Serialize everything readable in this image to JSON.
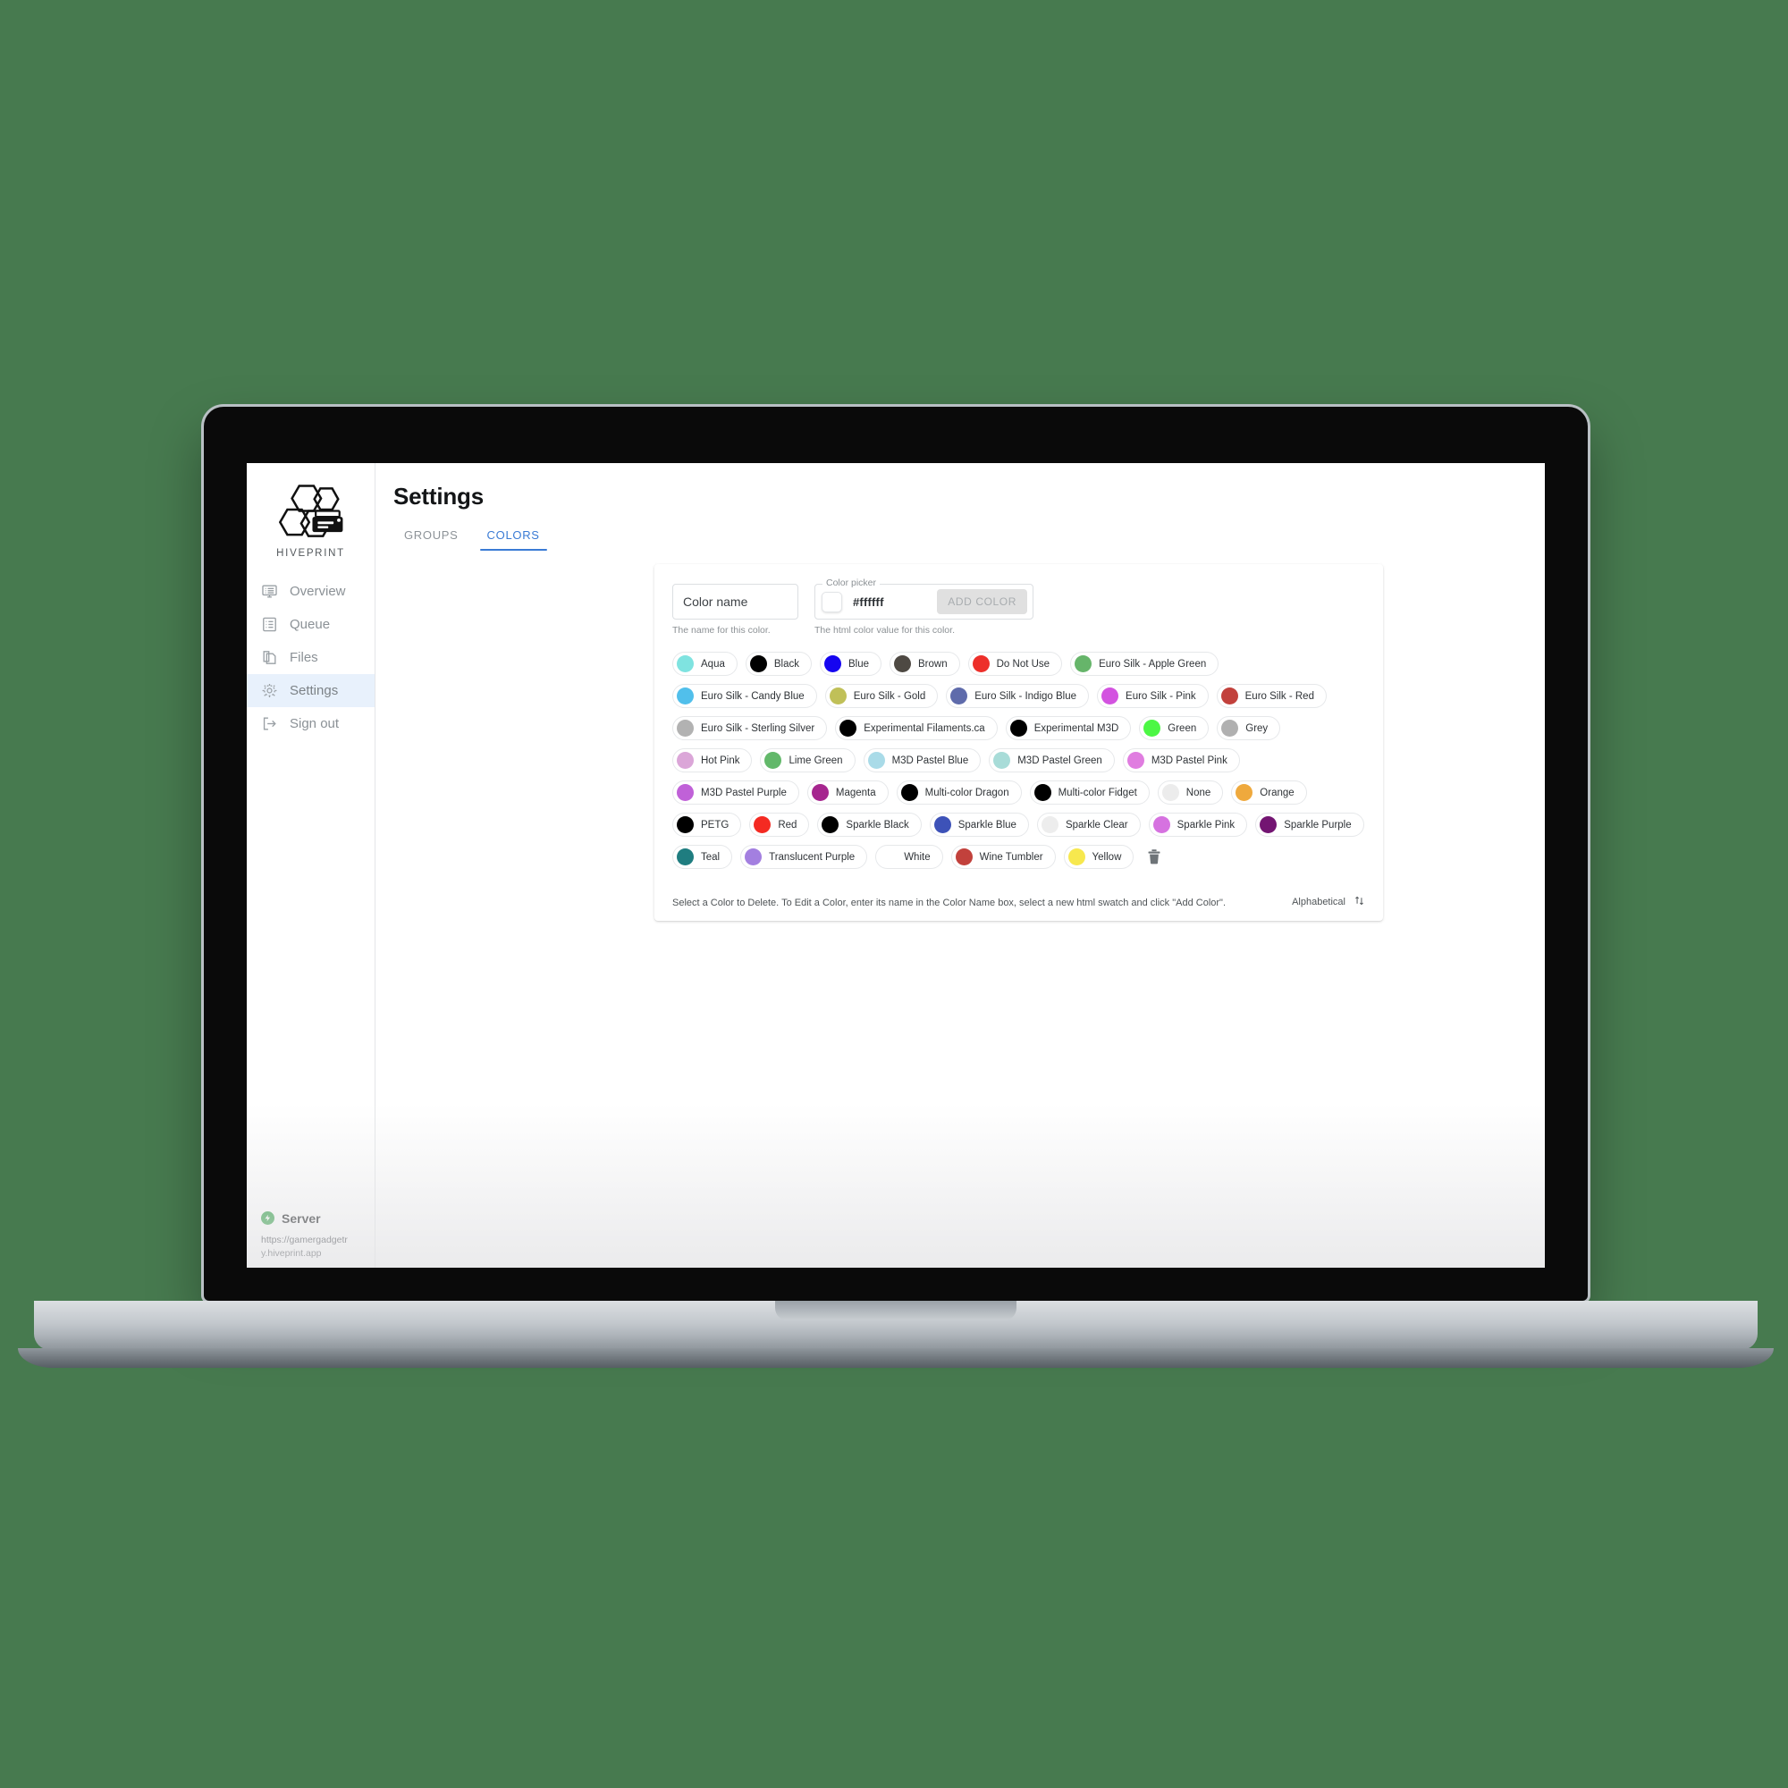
{
  "theme": {
    "background": "#477a4f",
    "accent": "#3a7bd5",
    "sidebar_active_bg": "#e8f1fc",
    "server_status_color": "#2e9e44"
  },
  "sidebar": {
    "brand_name": "HIVEPRINT",
    "brand_logo_icon": "hive-printer-logo",
    "items": [
      {
        "label": "Overview",
        "icon": "dashboard-icon",
        "active": false
      },
      {
        "label": "Queue",
        "icon": "list-icon",
        "active": false
      },
      {
        "label": "Files",
        "icon": "files-icon",
        "active": false
      },
      {
        "label": "Settings",
        "icon": "gear-icon",
        "active": true
      },
      {
        "label": "Sign out",
        "icon": "sign-out-icon",
        "active": false
      }
    ],
    "server": {
      "status_icon": "lightning-bolt-icon",
      "label": "Server",
      "url": "https://gamergadgetry.hiveprint.app"
    }
  },
  "header": {
    "title": "Settings",
    "tabs": [
      {
        "label": "GROUPS",
        "active": false
      },
      {
        "label": "COLORS",
        "active": true
      }
    ]
  },
  "form": {
    "color_name": {
      "placeholder": "Color name",
      "value": "",
      "help": "The name for this color."
    },
    "color_picker": {
      "legend": "Color picker",
      "swatch_hex": "#ffffff",
      "hex_value": "#ffffff",
      "help": "The html color value for this color."
    },
    "add_color_label": "ADD COLOR"
  },
  "colors": [
    {
      "name": "Aqua",
      "hex": "#7fe3e0"
    },
    {
      "name": "Black",
      "hex": "#000000"
    },
    {
      "name": "Blue",
      "hex": "#1505f0"
    },
    {
      "name": "Brown",
      "hex": "#4e4943"
    },
    {
      "name": "Do Not Use",
      "hex": "#ed2f2a"
    },
    {
      "name": "Euro Silk - Apple Green",
      "hex": "#66b56a"
    },
    {
      "name": "Euro Silk - Candy Blue",
      "hex": "#51bfeb"
    },
    {
      "name": "Euro Silk - Gold",
      "hex": "#c0c058"
    },
    {
      "name": "Euro Silk - Indigo Blue",
      "hex": "#5f6bab"
    },
    {
      "name": "Euro Silk - Pink",
      "hex": "#d353e0"
    },
    {
      "name": "Euro Silk - Red",
      "hex": "#c2413c"
    },
    {
      "name": "Euro Silk - Sterling Silver",
      "hex": "#b2b2b2"
    },
    {
      "name": "Experimental Filaments.ca",
      "hex": "#000000"
    },
    {
      "name": "Experimental M3D",
      "hex": "#000000"
    },
    {
      "name": "Green",
      "hex": "#4cf744"
    },
    {
      "name": "Grey",
      "hex": "#b0b0b0"
    },
    {
      "name": "Hot Pink",
      "hex": "#dba6d8"
    },
    {
      "name": "Lime Green",
      "hex": "#62b86a"
    },
    {
      "name": "M3D Pastel Blue",
      "hex": "#a9dbe8"
    },
    {
      "name": "M3D Pastel Green",
      "hex": "#a8dcd8"
    },
    {
      "name": "M3D Pastel Pink",
      "hex": "#e07de0"
    },
    {
      "name": "M3D Pastel Purple",
      "hex": "#c061d8"
    },
    {
      "name": "Magenta",
      "hex": "#a6268f"
    },
    {
      "name": "Multi-color Dragon",
      "hex": "#000000"
    },
    {
      "name": "Multi-color Fidget",
      "hex": "#000000"
    },
    {
      "name": "None",
      "hex": "#ececec"
    },
    {
      "name": "Orange",
      "hex": "#efa93d"
    },
    {
      "name": "PETG",
      "hex": "#000000"
    },
    {
      "name": "Red",
      "hex": "#f42a22"
    },
    {
      "name": "Sparkle Black",
      "hex": "#000000"
    },
    {
      "name": "Sparkle Blue",
      "hex": "#3d52b8"
    },
    {
      "name": "Sparkle Clear",
      "hex": "#ededed"
    },
    {
      "name": "Sparkle Pink",
      "hex": "#d672e0"
    },
    {
      "name": "Sparkle Purple",
      "hex": "#731572"
    },
    {
      "name": "Teal",
      "hex": "#1f7d80"
    },
    {
      "name": "Translucent Purple",
      "hex": "#a37fe0"
    },
    {
      "name": "White",
      "hex": "#ffffff"
    },
    {
      "name": "Wine Tumbler",
      "hex": "#c2413c"
    },
    {
      "name": "Yellow",
      "hex": "#f7e84e"
    }
  ],
  "delete_button_icon": "trash-icon",
  "footer": {
    "note": "Select a Color to Delete. To Edit a Color, enter its name in the Color Name box, select a new html swatch and click \"Add Color\".",
    "sort_label": "Alphabetical",
    "sort_icon": "sort-updown-icon"
  }
}
